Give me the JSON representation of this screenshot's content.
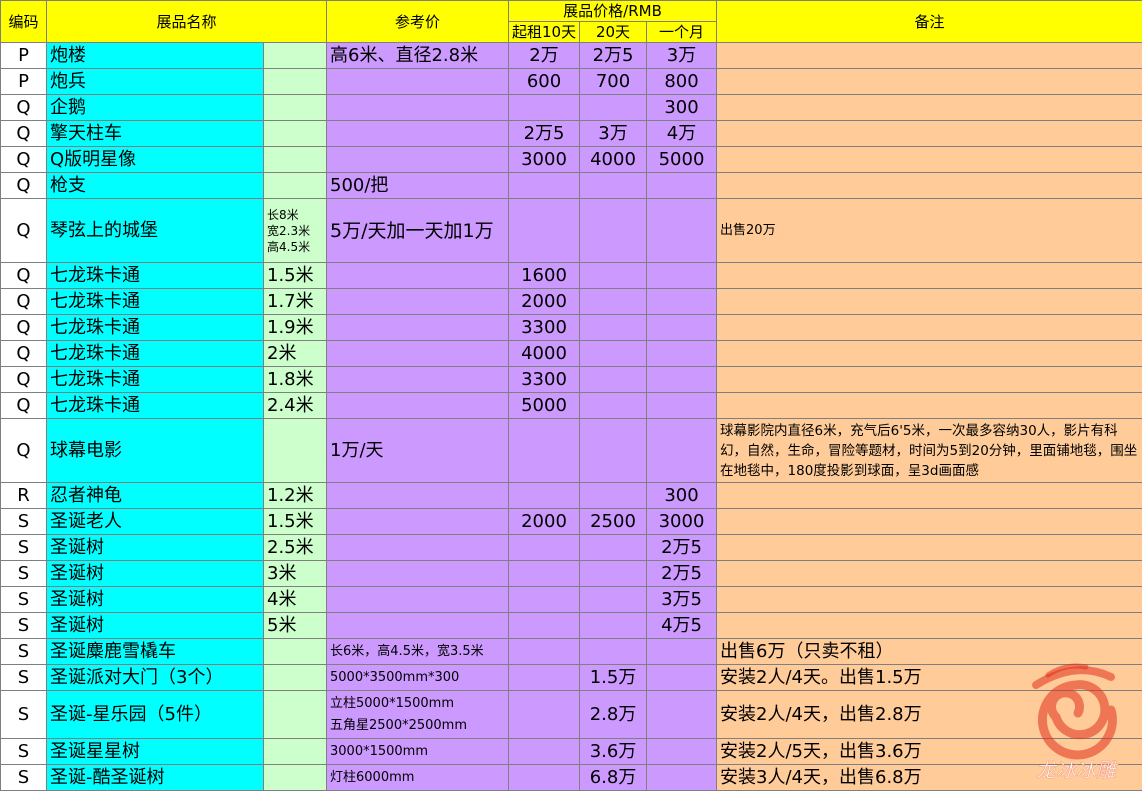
{
  "header": {
    "code": "编码",
    "name": "展品名称",
    "ref_price": "参考价",
    "price_group": "展品价格/RMB",
    "p10": "起租10天",
    "p20": "20天",
    "p30": "一个月",
    "note": "备注"
  },
  "rows": [
    {
      "code": "P",
      "name": "炮楼",
      "spec": "",
      "ref": "高6米、直径2.8米",
      "p10": "2万",
      "p20": "2万5",
      "p30": "3万",
      "note": ""
    },
    {
      "code": "P",
      "name": "炮兵",
      "spec": "",
      "ref": "",
      "p10": "600",
      "p20": "700",
      "p30": "800",
      "note": ""
    },
    {
      "code": "Q",
      "name": "企鹅",
      "spec": "",
      "ref": "",
      "p10": "",
      "p20": "",
      "p30": "300",
      "note": ""
    },
    {
      "code": "Q",
      "name": "擎天柱车",
      "spec": "",
      "ref": "",
      "p10": "2万5",
      "p20": "3万",
      "p30": "4万",
      "note": ""
    },
    {
      "code": "Q",
      "name": "Q版明星像",
      "spec": "",
      "ref": "",
      "p10": "3000",
      "p20": "4000",
      "p30": "5000",
      "note": ""
    },
    {
      "code": "Q",
      "name": "枪支",
      "spec": "",
      "ref": "500/把",
      "p10": "",
      "p20": "",
      "p30": "",
      "note": ""
    },
    {
      "code": "Q",
      "name": "琴弦上的城堡",
      "spec": "长8米 宽2.3米 高4.5米",
      "ref": "5万/天加一天加1万",
      "p10": "",
      "p20": "",
      "p30": "",
      "note": "出售20万"
    },
    {
      "code": "Q",
      "name": "七龙珠卡通",
      "spec": "1.5米",
      "ref": "",
      "p10": "1600",
      "p20": "",
      "p30": "",
      "note": ""
    },
    {
      "code": "Q",
      "name": "七龙珠卡通",
      "spec": "1.7米",
      "ref": "",
      "p10": "2000",
      "p20": "",
      "p30": "",
      "note": ""
    },
    {
      "code": "Q",
      "name": "七龙珠卡通",
      "spec": "1.9米",
      "ref": "",
      "p10": "3300",
      "p20": "",
      "p30": "",
      "note": ""
    },
    {
      "code": "Q",
      "name": "七龙珠卡通",
      "spec": "2米",
      "ref": "",
      "p10": "4000",
      "p20": "",
      "p30": "",
      "note": ""
    },
    {
      "code": "Q",
      "name": "七龙珠卡通",
      "spec": "1.8米",
      "ref": "",
      "p10": "3300",
      "p20": "",
      "p30": "",
      "note": ""
    },
    {
      "code": "Q",
      "name": "七龙珠卡通",
      "spec": "2.4米",
      "ref": "",
      "p10": "5000",
      "p20": "",
      "p30": "",
      "note": ""
    },
    {
      "code": "Q",
      "name": "球幕电影",
      "spec": "",
      "ref": "1万/天",
      "p10": "",
      "p20": "",
      "p30": "",
      "note": "球幕影院内直径6米，充气后6'5米，一次最多容纳30人，影片有科幻，自然，生命，冒险等题材，时间为5到20分钟，里面铺地毯，围坐在地毯中，180度投影到球面，呈3d画面感"
    },
    {
      "code": "R",
      "name": "忍者神龟",
      "spec": "1.2米",
      "ref": "",
      "p10": "",
      "p20": "",
      "p30": "300",
      "note": ""
    },
    {
      "code": "S",
      "name": "圣诞老人",
      "spec": "1.5米",
      "ref": "",
      "p10": "2000",
      "p20": "2500",
      "p30": "3000",
      "note": ""
    },
    {
      "code": "S",
      "name": "圣诞树",
      "spec": "2.5米",
      "ref": "",
      "p10": "",
      "p20": "",
      "p30": "2万5",
      "note": ""
    },
    {
      "code": "S",
      "name": "圣诞树",
      "spec": "3米",
      "ref": "",
      "p10": "",
      "p20": "",
      "p30": "2万5",
      "note": ""
    },
    {
      "code": "S",
      "name": "圣诞树",
      "spec": "4米",
      "ref": "",
      "p10": "",
      "p20": "",
      "p30": "3万5",
      "note": ""
    },
    {
      "code": "S",
      "name": "圣诞树",
      "spec": "5米",
      "ref": "",
      "p10": "",
      "p20": "",
      "p30": "4万5",
      "note": ""
    },
    {
      "code": "S",
      "name": "圣诞麋鹿雪橇车",
      "spec": "",
      "ref": "长6米，高4.5米，宽3.5米",
      "p10": "",
      "p20": "",
      "p30": "",
      "note": "出售6万（只卖不租）"
    },
    {
      "code": "S",
      "name": "圣诞派对大门（3个）",
      "spec": "",
      "ref": "5000*3500mm*300",
      "p10": "",
      "p20": "1.5万",
      "p30": "",
      "note": "安装2人/4天。出售1.5万"
    },
    {
      "code": "S",
      "name": "圣诞-星乐园（5件）",
      "spec": "",
      "ref": "立柱5000*1500mm 五角星2500*2500mm",
      "p10": "",
      "p20": "2.8万",
      "p30": "",
      "note": "安装2人/4天，出售2.8万"
    },
    {
      "code": "S",
      "name": "圣诞星星树",
      "spec": "",
      "ref": "3000*1500mm",
      "p10": "",
      "p20": "3.6万",
      "p30": "",
      "note": "安装2人/5天，出售3.6万"
    },
    {
      "code": "S",
      "name": "圣诞-酷圣诞树",
      "spec": "",
      "ref": "灯柱6000mm",
      "p10": "",
      "p20": "6.8万",
      "p30": "",
      "note": "安装3人/4天，出售6.8万"
    }
  ],
  "watermark": {
    "text": "龙冰冰雕",
    "icon": "spiral-logo-icon",
    "color": "#e0301e"
  }
}
